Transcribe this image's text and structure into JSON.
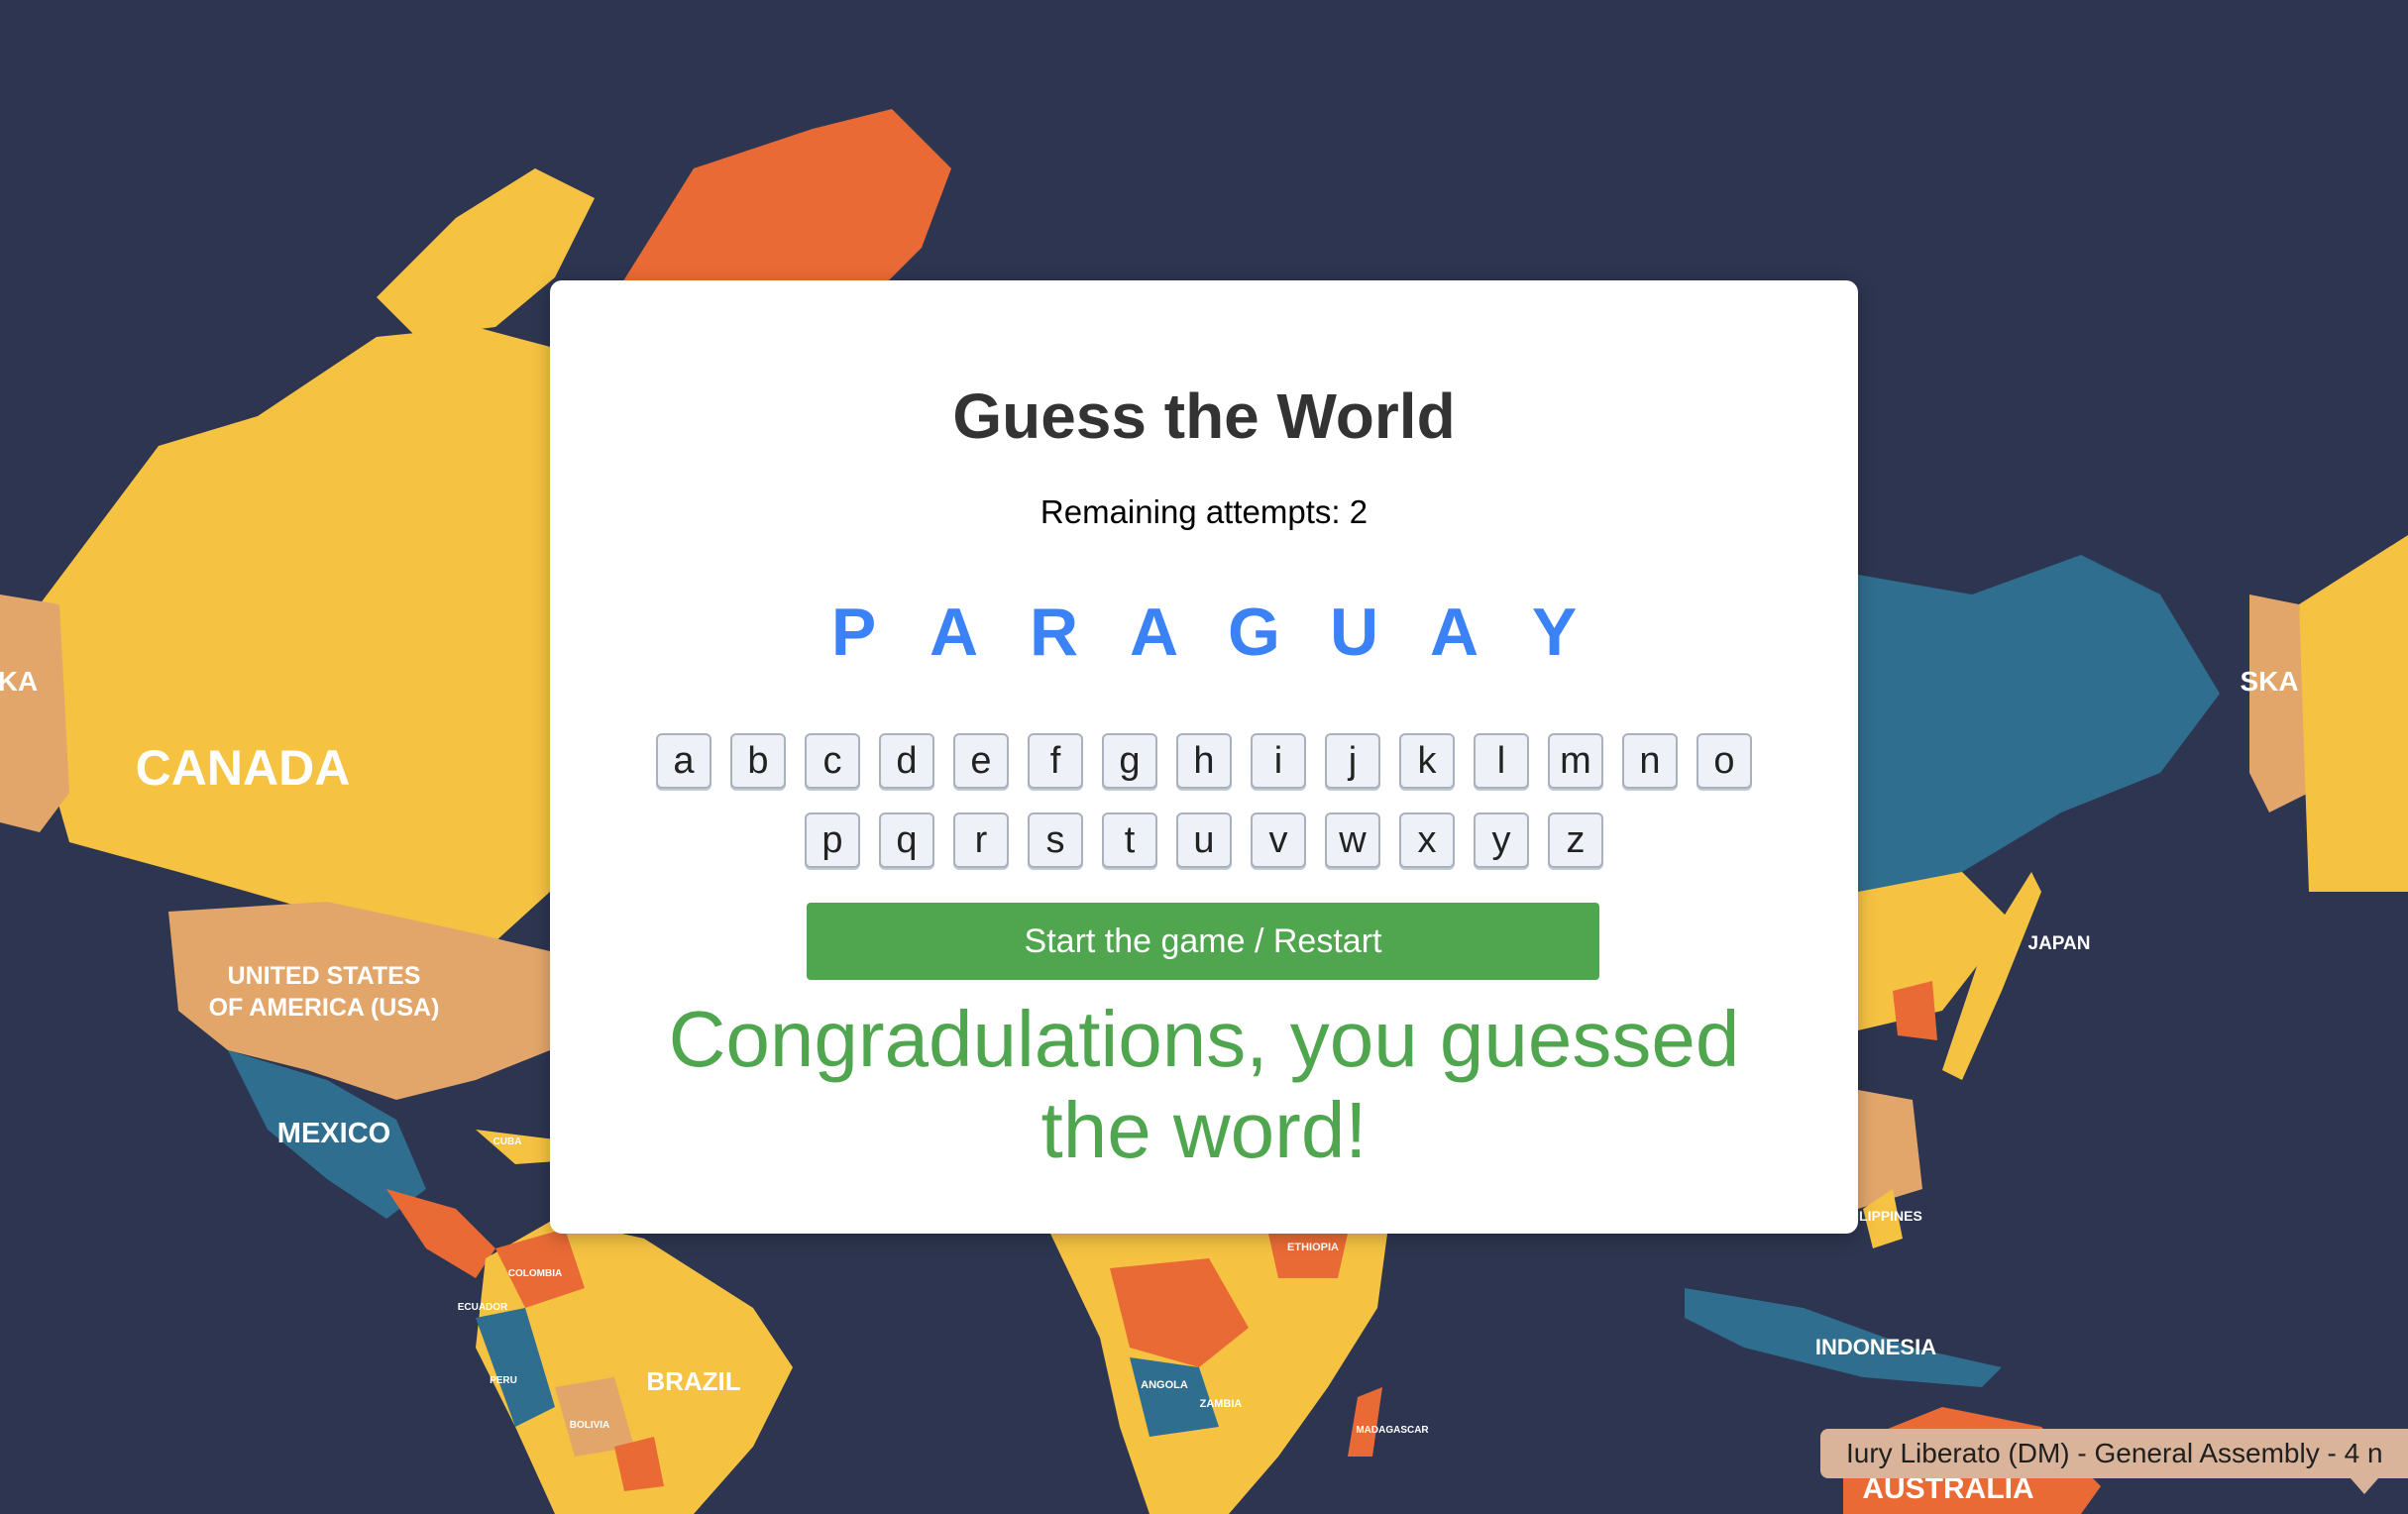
{
  "game": {
    "title": "Guess the World",
    "attempts_label": "Remaining attempts: 2",
    "word": [
      "P",
      "A",
      "R",
      "A",
      "G",
      "U",
      "A",
      "Y"
    ],
    "keyboard_row1": [
      "a",
      "b",
      "c",
      "d",
      "e",
      "f",
      "g",
      "h",
      "i",
      "j",
      "k",
      "l",
      "m",
      "n",
      "o"
    ],
    "keyboard_row2": [
      "p",
      "q",
      "r",
      "s",
      "t",
      "u",
      "v",
      "w",
      "x",
      "y",
      "z"
    ],
    "start_button_label": "Start the game / Restart",
    "result_message": "Congradulations, you guessed the word!",
    "word_color": "#3b82f6",
    "success_color": "#4fa64f"
  },
  "map": {
    "background_color": "#2d3550",
    "labels": {
      "canada": "CANADA",
      "usa_line1": "UNITED STATES",
      "usa_line2": "OF AMERICA (USA)",
      "mexico": "MEXICO",
      "brazil": "BRAZIL",
      "indonesia": "INDONESIA",
      "japan": "JAPAN",
      "australia": "AUSTRALIA",
      "cuba": "CUBA",
      "colombia": "COLOMBIA",
      "ecuador": "ECUADOR",
      "peru": "PERU",
      "bolivia": "BOLIVIA",
      "ethiopia": "ETHIOPIA",
      "angola": "ANGOLA",
      "zambia": "ZAMBIA",
      "madagascar": "MADAGASCAR",
      "philippines": "ILIPPINES",
      "alaska_left": "KA",
      "alaska_right": "SKA"
    },
    "colors": {
      "yellow": "#f5c242",
      "orange": "#e96a35",
      "tan": "#e2a66a",
      "teal": "#2f6e8e"
    }
  },
  "notification": {
    "text": "Iury Liberato (DM) - General Assembly - 4 n"
  }
}
